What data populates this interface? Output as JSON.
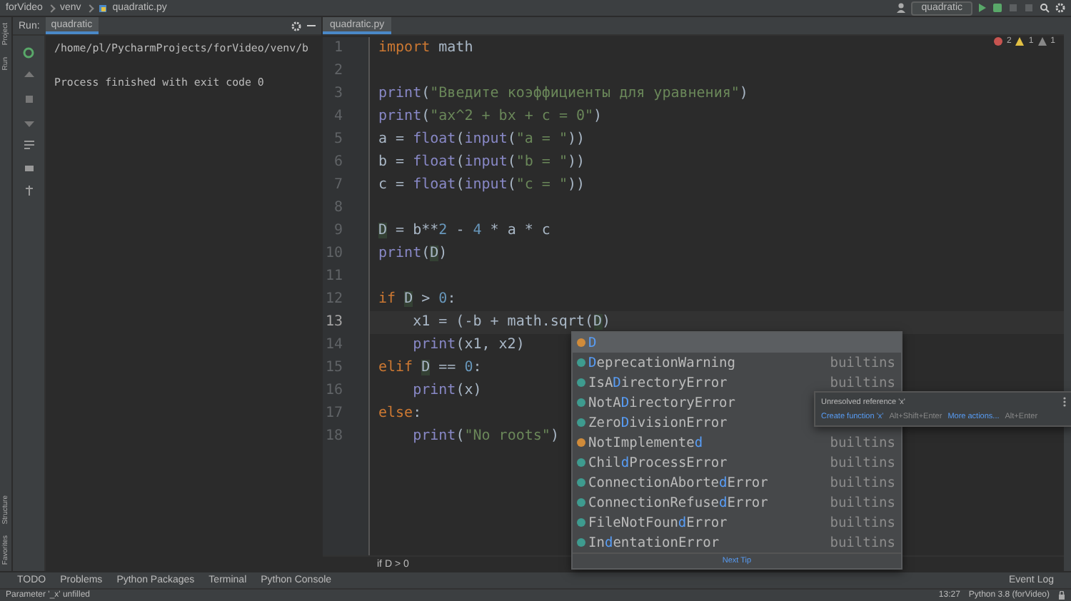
{
  "navbar": {
    "breadcrumbs": [
      "forVideo",
      "venv",
      "quadratic.py"
    ],
    "run_config": "quadratic"
  },
  "left_stripe": {
    "top": [
      "Project",
      "Run"
    ],
    "bottom": [
      "Structure",
      "Favorites"
    ]
  },
  "run_panel": {
    "label": "Run:",
    "tab": {
      "label": "quadratic",
      "selected": true
    },
    "command": "/home/pl/PycharmProjects/forVideo/venv/b",
    "result": "Process finished with exit code 0"
  },
  "editor": {
    "tab": {
      "label": "quadratic.py",
      "selected": true
    },
    "inspections": {
      "errors": "2",
      "warnings": "1",
      "weak": "1"
    },
    "lines": [
      {
        "number": "1",
        "current": false,
        "tokens": [
          {
            "kind": "kw",
            "text": "import"
          },
          {
            "kind": "plain",
            "text": " math"
          }
        ]
      },
      {
        "number": "2",
        "current": false
      },
      {
        "number": "3",
        "current": false,
        "tokens": [
          {
            "kind": "builtin",
            "text": "print"
          },
          {
            "kind": "plain",
            "text": "("
          },
          {
            "kind": "str",
            "text": "\"Введите коэффициенты для уравнения\""
          },
          {
            "kind": "plain",
            "text": ")"
          }
        ]
      },
      {
        "number": "4",
        "current": false,
        "tokens": [
          {
            "kind": "builtin",
            "text": "print"
          },
          {
            "kind": "plain",
            "text": "("
          },
          {
            "kind": "str",
            "text": "\"ax^2 + bx + c = 0\""
          },
          {
            "kind": "plain",
            "text": ")"
          }
        ]
      },
      {
        "number": "5",
        "current": false,
        "tokens": [
          {
            "kind": "plain",
            "text": "a = "
          },
          {
            "kind": "builtin",
            "text": "float"
          },
          {
            "kind": "plain",
            "text": "("
          },
          {
            "kind": "builtin",
            "text": "input"
          },
          {
            "kind": "plain",
            "text": "("
          },
          {
            "kind": "str",
            "text": "\"a = \""
          },
          {
            "kind": "plain",
            "text": "))"
          }
        ]
      },
      {
        "number": "6",
        "current": false,
        "tokens": [
          {
            "kind": "plain",
            "text": "b = "
          },
          {
            "kind": "builtin",
            "text": "float"
          },
          {
            "kind": "plain",
            "text": "("
          },
          {
            "kind": "builtin",
            "text": "input"
          },
          {
            "kind": "plain",
            "text": "("
          },
          {
            "kind": "str",
            "text": "\"b = \""
          },
          {
            "kind": "plain",
            "text": "))"
          }
        ]
      },
      {
        "number": "7",
        "current": false,
        "tokens": [
          {
            "kind": "plain",
            "text": "c = "
          },
          {
            "kind": "builtin",
            "text": "float"
          },
          {
            "kind": "plain",
            "text": "("
          },
          {
            "kind": "builtin",
            "text": "input"
          },
          {
            "kind": "plain",
            "text": "("
          },
          {
            "kind": "str",
            "text": "\"c = \""
          },
          {
            "kind": "plain",
            "text": "))"
          }
        ]
      },
      {
        "number": "8",
        "current": false
      },
      {
        "number": "9",
        "current": false,
        "tokens": [
          {
            "kind": "ref",
            "text": "D"
          },
          {
            "kind": "plain",
            "text": " = b**"
          },
          {
            "kind": "num",
            "text": "2"
          },
          {
            "kind": "plain",
            "text": " - "
          },
          {
            "kind": "num",
            "text": "4"
          },
          {
            "kind": "plain",
            "text": " * a * c"
          }
        ]
      },
      {
        "number": "10",
        "current": false,
        "tokens": [
          {
            "kind": "builtin",
            "text": "print"
          },
          {
            "kind": "plain",
            "text": "("
          },
          {
            "kind": "ref",
            "text": "D"
          },
          {
            "kind": "plain",
            "text": ")"
          }
        ]
      },
      {
        "number": "11",
        "current": false
      },
      {
        "number": "12",
        "current": false,
        "tokens": [
          {
            "kind": "kw",
            "text": "if "
          },
          {
            "kind": "ref",
            "text": "D"
          },
          {
            "kind": "plain",
            "text": " > "
          },
          {
            "kind": "num",
            "text": "0"
          },
          {
            "kind": "plain",
            "text": ":"
          }
        ]
      },
      {
        "number": "13",
        "current": true,
        "tokens": [
          {
            "kind": "plain",
            "text": "    x1 = (-b + math.sqrt("
          },
          {
            "kind": "ref",
            "text": "D"
          },
          {
            "kind": "plain",
            "text": ")"
          }
        ]
      },
      {
        "number": "14",
        "current": false,
        "tokens": [
          {
            "kind": "builtin",
            "text": "    print"
          },
          {
            "kind": "plain",
            "text": "(x1, x2)"
          }
        ]
      },
      {
        "number": "15",
        "current": false,
        "tokens": [
          {
            "kind": "kw",
            "text": "elif "
          },
          {
            "kind": "ref",
            "text": "D"
          },
          {
            "kind": "plain",
            "text": " == "
          },
          {
            "kind": "num",
            "text": "0"
          },
          {
            "kind": "plain",
            "text": ":"
          }
        ]
      },
      {
        "number": "16",
        "current": false,
        "tokens": [
          {
            "kind": "builtin",
            "text": "    print"
          },
          {
            "kind": "plain",
            "text": "(x)"
          }
        ]
      },
      {
        "number": "17",
        "current": false,
        "tokens": [
          {
            "kind": "kw",
            "text": "else"
          },
          {
            "kind": "plain",
            "text": ":"
          }
        ]
      },
      {
        "number": "18",
        "current": false,
        "tokens": [
          {
            "kind": "builtin",
            "text": "    print"
          },
          {
            "kind": "plain",
            "text": "("
          },
          {
            "kind": "str",
            "text": "\"No roots\""
          },
          {
            "kind": "plain",
            "text": ")"
          }
        ]
      }
    ],
    "breadcrumb": "if D > 0"
  },
  "completion": {
    "items": [
      {
        "kind": "variable",
        "selected": true,
        "match": "D"
      },
      {
        "kind": "class",
        "selected": false,
        "match": "D",
        "after": "eprecationWarning",
        "source": "builtins"
      },
      {
        "kind": "class",
        "selected": false,
        "before": "IsA",
        "match": "D",
        "after": "irectoryError",
        "source": "builtins"
      },
      {
        "kind": "class",
        "selected": false,
        "before": "NotA",
        "match": "D",
        "after": "irectoryError"
      },
      {
        "kind": "class",
        "selected": false,
        "before": "Zero",
        "match": "D",
        "after": "ivisionError"
      },
      {
        "kind": "variable",
        "selected": false,
        "before": "NotImplemente",
        "match": "d",
        "source": "builtins"
      },
      {
        "kind": "class",
        "selected": false,
        "before": "Chil",
        "match": "d",
        "after": "ProcessError",
        "source": "builtins"
      },
      {
        "kind": "class",
        "selected": false,
        "before": "ConnectionAborte",
        "match": "d",
        "after": "Error",
        "source": "builtins"
      },
      {
        "kind": "class",
        "selected": false,
        "before": "ConnectionRefuse",
        "match": "d",
        "after": "Error",
        "source": "builtins"
      },
      {
        "kind": "class",
        "selected": false,
        "before": "FileNotFoun",
        "match": "d",
        "after": "Error",
        "source": "builtins"
      },
      {
        "kind": "class",
        "selected": false,
        "before": "In",
        "match": "d",
        "after": "entationError",
        "source": "builtins"
      }
    ],
    "footer_link": "Next Tip"
  },
  "tooltip": {
    "message": "Unresolved reference 'x'",
    "action": "Create function 'x'",
    "action_shortcut": "Alt+Shift+Enter",
    "more": "More actions...",
    "more_shortcut": "Alt+Enter"
  },
  "tool_tabs": [
    "TODO",
    "Problems",
    "Python Packages",
    "Terminal",
    "Python Console"
  ],
  "event_log": "Event Log",
  "status": {
    "message": "Parameter '_x' unfilled",
    "position": "13:27",
    "interpreter": "Python 3.8 (forVideo)"
  }
}
